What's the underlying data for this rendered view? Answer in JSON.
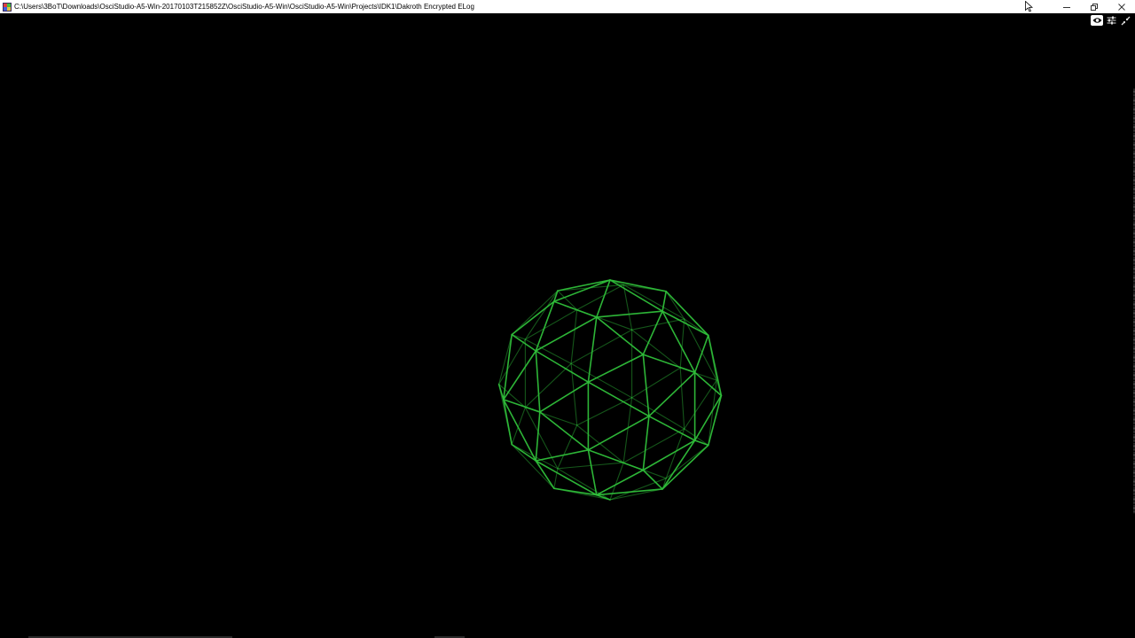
{
  "window": {
    "title": "C:\\Users\\3BoT\\Downloads\\OsciStudio-A5-Win-20170103T215852Z\\OsciStudio-A5-Win\\OsciStudio-A5-Win\\Projects\\IDK1\\Dakroth Encrypted ELog",
    "controls": [
      "minimize-icon",
      "restore-icon",
      "close-icon"
    ]
  },
  "toolbar": {
    "buttons": [
      {
        "icon": "eye-icon",
        "active": true
      },
      {
        "icon": "sliders-icon",
        "active": false
      },
      {
        "icon": "collapse-arrows-icon",
        "active": false
      }
    ]
  },
  "scene": {
    "background": "#000000",
    "wire_color": "#2fbf3a",
    "shape": "geodesic-sphere-wireframe"
  }
}
